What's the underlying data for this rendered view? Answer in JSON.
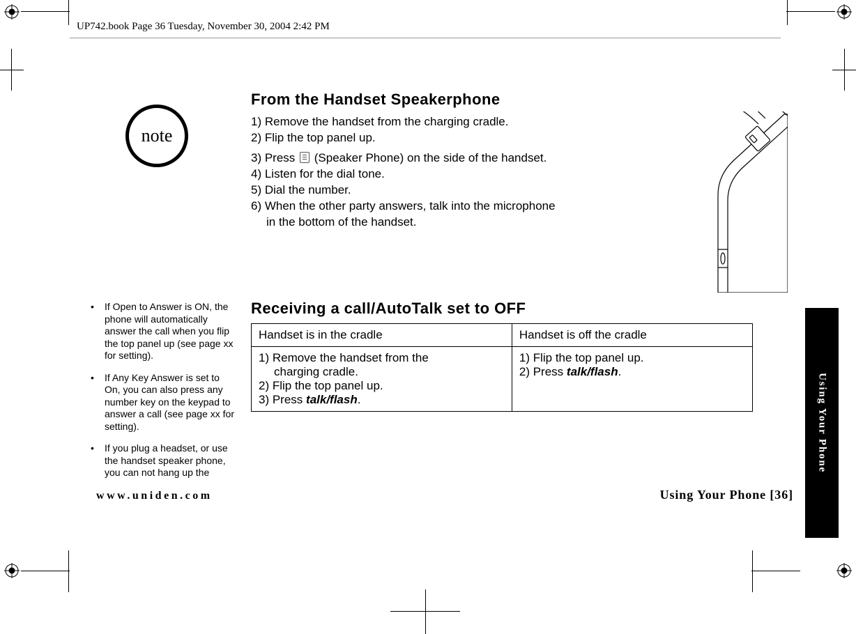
{
  "page_header": "UP742.book  Page 36  Tuesday, November 30, 2004  2:42 PM",
  "note_label": "note",
  "section1_title": "From the Handset Speakerphone",
  "section1_steps": [
    "1) Remove the handset from the charging cradle.",
    "2) Flip the top panel up.",
    "3) Press   (Speaker Phone) on the side of the handset.",
    "4) Listen for the dial tone.",
    "5) Dial the number.",
    "6) When the other party answers, talk into the microphone",
    "in the bottom of the handset."
  ],
  "left_notes": [
    "If Open to Answer is ON, the phone will automatically answer the call when you flip the top panel up (see page xx for setting).",
    "If Any Key Answer is set to On, you can also press any number key on the keypad to answer a call (see page xx for setting).",
    "If you plug a headset, or use the handset speaker phone, you can not hang up the"
  ],
  "section2_title": "Receiving a call/AutoTalk set to OFF",
  "table": {
    "head": [
      "Handset is in the cradle",
      "Handset is off the cradle"
    ],
    "cell_left": [
      "1) Remove the handset from the",
      "charging cradle.",
      "2) Flip the top panel up.",
      "3) Press "
    ],
    "cell_right": [
      "1) Flip the top panel up.",
      "2) Press "
    ],
    "talkflash": "talk/flash",
    "period": "."
  },
  "footer_url": "www.uniden.com",
  "footer_right": "Using Your Phone [36]",
  "side_tab": "Using Your Phone"
}
